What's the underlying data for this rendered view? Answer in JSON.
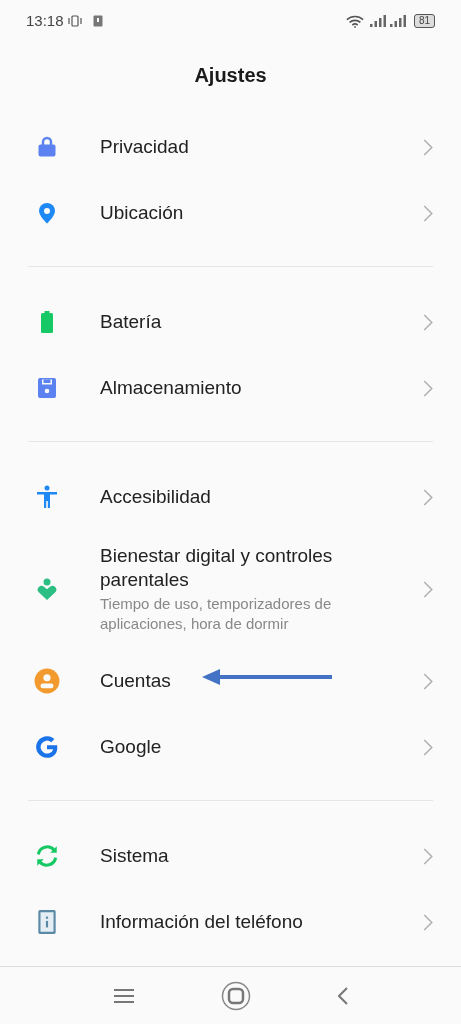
{
  "status_bar": {
    "time": "13:18",
    "battery": "81"
  },
  "title": "Ajustes",
  "sections": [
    {
      "items": [
        {
          "label": "Privacidad",
          "arrow_pointing": false
        },
        {
          "label": "Ubicación",
          "arrow_pointing": false
        }
      ]
    },
    {
      "items": [
        {
          "label": "Batería",
          "arrow_pointing": false
        },
        {
          "label": "Almacenamiento",
          "arrow_pointing": false
        }
      ]
    },
    {
      "items": [
        {
          "label": "Accesibilidad",
          "arrow_pointing": false
        },
        {
          "label": "Bienestar digital y controles parentales",
          "subtitle": "Tiempo de uso, temporizadores de aplicaciones, hora de dormir",
          "arrow_pointing": false
        },
        {
          "label": "Cuentas",
          "arrow_pointing": true
        },
        {
          "label": "Google",
          "arrow_pointing": false
        }
      ]
    },
    {
      "items": [
        {
          "label": "Sistema",
          "arrow_pointing": false
        },
        {
          "label": "Información del teléfono",
          "arrow_pointing": false
        }
      ]
    }
  ]
}
